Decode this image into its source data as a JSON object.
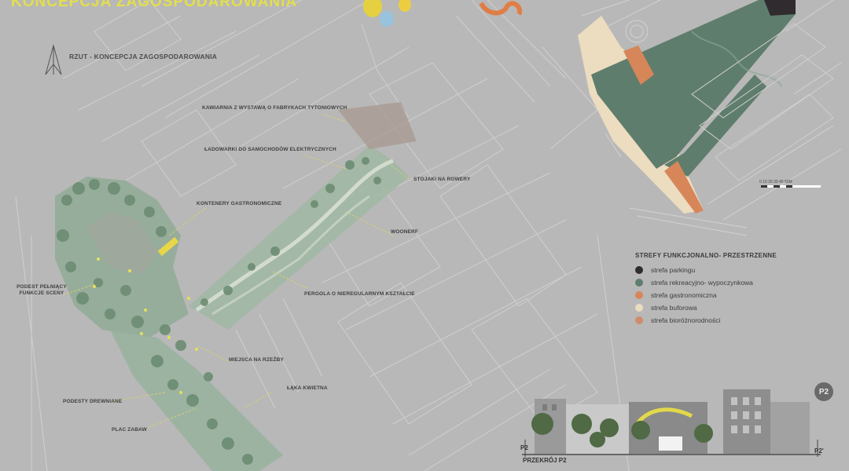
{
  "poster": {
    "title": "KONCEPCJA ZAGOSPODAROWANIA",
    "plan_title": "RZUT - KONCEPCJA ZAGOSPODAROWANIA"
  },
  "labels": {
    "kawiarnia": "KAWIARNIA Z WYSTAWĄ O FABRYKACH TYTONIOWYCH",
    "ladowarki": "ŁADOWARKI DO SAMOCHODÓW ELEKTRYCZNYCH",
    "stojaki": "STOJAKI NA ROWERY",
    "kontenery": "KONTENERY GASTRONOMICZNE",
    "woonerf": "WOONERF",
    "podest_scena": "PODEST PEŁNIĄCY FUNKCJE SCENY",
    "pergola": "PERGOLA O NIEREGULARNYM KSZTAŁCIE",
    "miejsca_rzezby": "MIEJSCA NA RZEŹBY",
    "laka": "ŁĄKA KWIETNA",
    "podesty": "PODESTY DREWNIANE",
    "plac": "PLAC ZABAW"
  },
  "legend": {
    "title": "STREFY FUNKCJONALNO- PRZESTRZENNE",
    "items": [
      {
        "label": "strefa parkingu",
        "color": "#2f2b2e"
      },
      {
        "label": "strefa rekreacyjno- wypoczynkowa",
        "color": "#5f7d6d"
      },
      {
        "label": "strefa gastronomiczna",
        "color": "#d7865a"
      },
      {
        "label": "strefa buforowa",
        "color": "#ecdcc0"
      },
      {
        "label": "strefa bioróżnorodności",
        "color": "#cf8c6c"
      }
    ]
  },
  "scale_bar": {
    "labels": "0   10   20   30   40   50M"
  },
  "section": {
    "title": "PRZEKRÓJ P2",
    "mark_left": "P2",
    "mark_right": "P2'",
    "badge": "P2"
  }
}
